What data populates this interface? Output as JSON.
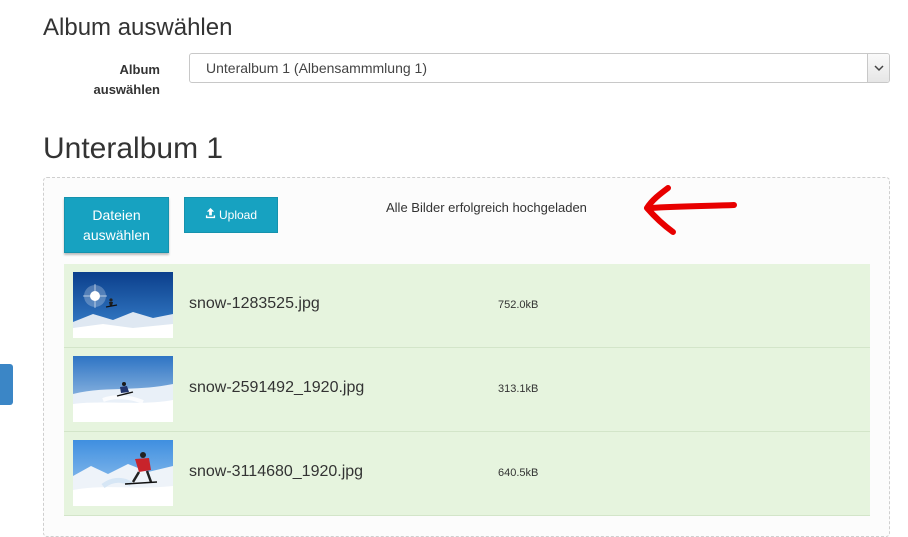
{
  "album_section": {
    "heading": "Album auswählen",
    "label_line1": "Album",
    "label_line2": "auswählen",
    "selected_option": "Unteralbum 1 (Albensammmlung 1)"
  },
  "album_title": "Unteralbum 1",
  "upload": {
    "select_files_line1": "Dateien",
    "select_files_line2": "auswählen",
    "upload_label": "Upload",
    "status_message": "Alle Bilder erfolgreich hochgeladen"
  },
  "files": [
    {
      "name": "snow-1283525.jpg",
      "size": "752.0kB"
    },
    {
      "name": "snow-2591492_1920.jpg",
      "size": "313.1kB"
    },
    {
      "name": "snow-3114680_1920.jpg",
      "size": "640.5kB"
    }
  ],
  "colors": {
    "accent_button": "#17a2c1",
    "success_row": "#e6f4de",
    "annotation_arrow": "#e80000"
  }
}
